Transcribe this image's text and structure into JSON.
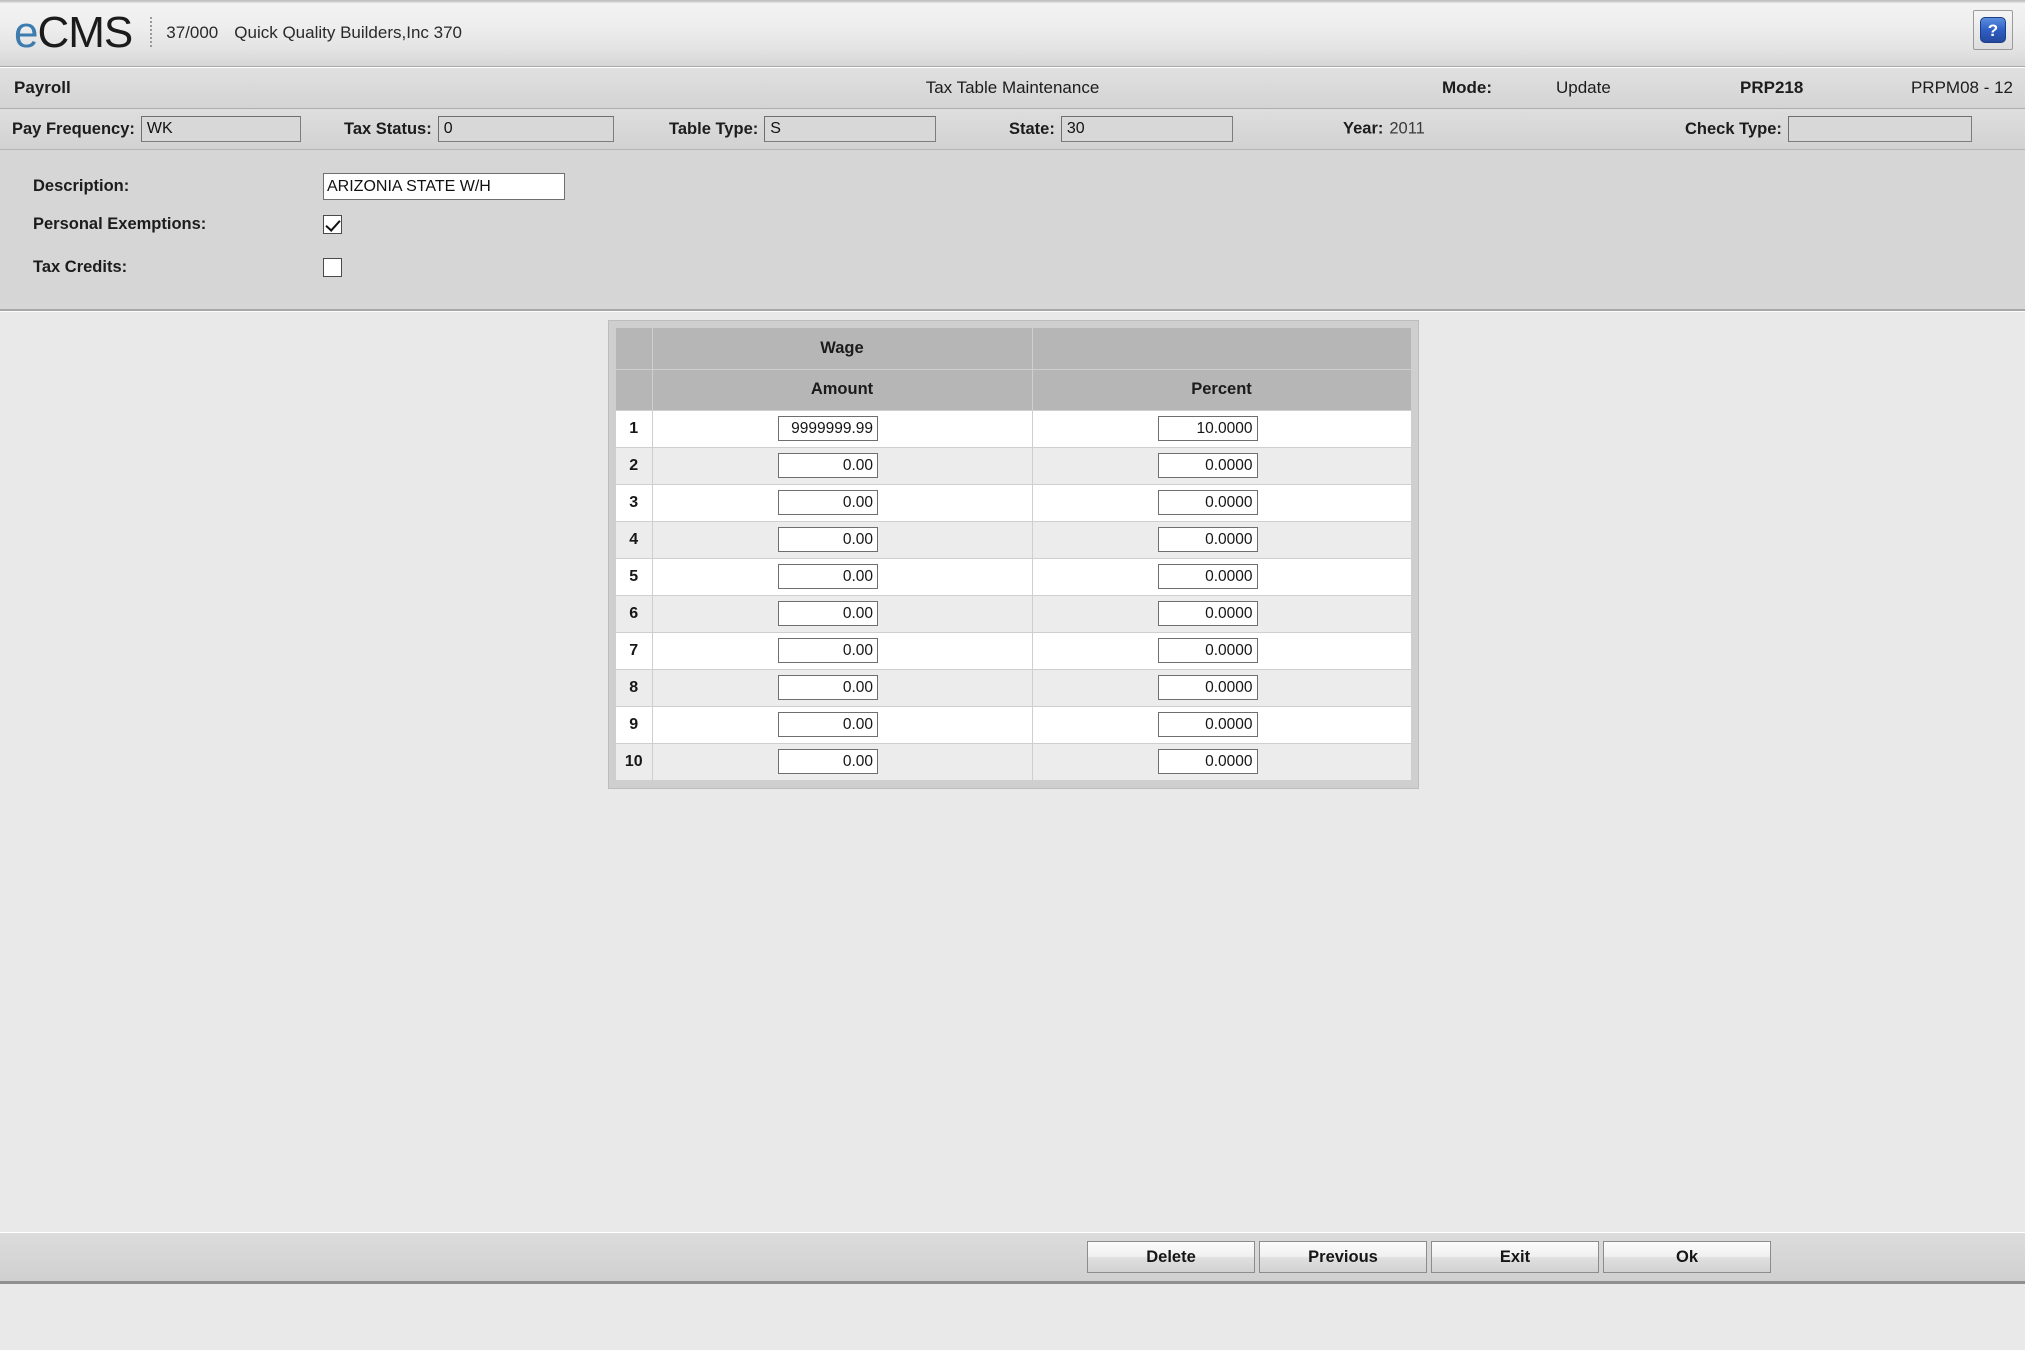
{
  "brand": {
    "logo_e": "e",
    "logo_cms": "CMS",
    "company_number": "37/000",
    "company_name": "Quick Quality Builders,Inc 370",
    "help_glyph": "?"
  },
  "titlebar": {
    "module": "Payroll",
    "title": "Tax Table Maintenance",
    "mode_label": "Mode:",
    "mode_value": "Update",
    "program_id": "PRP218",
    "screen_id": "PRPM08 - 12"
  },
  "criteria": [
    {
      "label": "Pay Frequency:",
      "value": "WK"
    },
    {
      "label": "Tax Status:",
      "value": "0"
    },
    {
      "label": "Table Type:",
      "value": "S"
    },
    {
      "label": "State:",
      "value": "30"
    },
    {
      "label": "Year:",
      "value": "2011"
    },
    {
      "label": "Check Type:",
      "value": ""
    }
  ],
  "detail": {
    "description_label": "Description:",
    "description_value": "ARIZONIA STATE W/H",
    "personal_exemptions_label": "Personal Exemptions:",
    "personal_exemptions_checked": true,
    "tax_credits_label": "Tax Credits:",
    "tax_credits_checked": false
  },
  "grid": {
    "group_header": "Wage",
    "columns": [
      "Amount",
      "Percent"
    ],
    "rows": [
      {
        "index": "1",
        "amount": "9999999.99",
        "percent": "10.0000"
      },
      {
        "index": "2",
        "amount": "0.00",
        "percent": "0.0000"
      },
      {
        "index": "3",
        "amount": "0.00",
        "percent": "0.0000"
      },
      {
        "index": "4",
        "amount": "0.00",
        "percent": "0.0000"
      },
      {
        "index": "5",
        "amount": "0.00",
        "percent": "0.0000"
      },
      {
        "index": "6",
        "amount": "0.00",
        "percent": "0.0000"
      },
      {
        "index": "7",
        "amount": "0.00",
        "percent": "0.0000"
      },
      {
        "index": "8",
        "amount": "0.00",
        "percent": "0.0000"
      },
      {
        "index": "9",
        "amount": "0.00",
        "percent": "0.0000"
      },
      {
        "index": "10",
        "amount": "0.00",
        "percent": "0.0000"
      }
    ]
  },
  "footer": {
    "buttons": [
      {
        "label": "Delete"
      },
      {
        "label": "Previous"
      },
      {
        "label": "Exit"
      },
      {
        "label": "Ok"
      }
    ]
  },
  "colors": {
    "logo_accent": "#3d7cae",
    "help_button": "#2f5fc4",
    "header_row": "#b6b6b6",
    "panel_bg": "#d6d6d6",
    "canvas_bg": "#e9e9e9"
  }
}
